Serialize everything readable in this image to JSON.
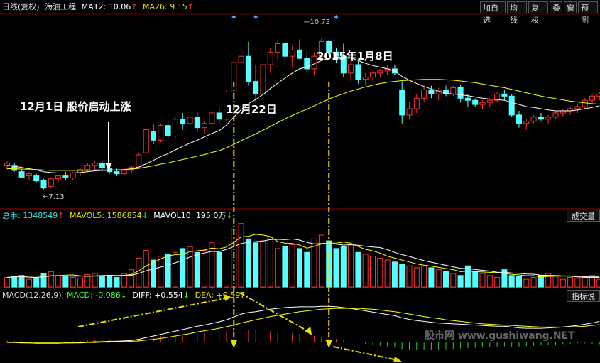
{
  "header": {
    "period": "日线(复权)",
    "stock_name": "海油工程",
    "ma12_label": "MA12:",
    "ma12_value": "10.06",
    "ma26_label": "MA26:",
    "ma26_value": "9.15",
    "arrow_up": "↑",
    "arrow_down": "↓"
  },
  "toolbar": {
    "buttons": [
      "加自选",
      "均线",
      "复权",
      "叠",
      "窗",
      "预测"
    ]
  },
  "volume_header": {
    "total_label": "总手:",
    "total_value": "1348549",
    "mavol5_label": "MAVOL5:",
    "mavol5_value": "1586854",
    "mavol10_label": "MAVOL10:",
    "mavol10_value": "195.0万"
  },
  "volume_tab": "成交量",
  "macd_header": {
    "name": "MACD(12,26,9)",
    "macd_label": "MACD:",
    "macd_value": "-0.086",
    "diff_label": "DIFF:",
    "diff_value": "+0.554",
    "dea_label": "DEA:",
    "dea_value": "+0.597"
  },
  "macd_tab": "指标说",
  "annotations": {
    "dec1": "12月1日 股价启动上涨",
    "dec22": "12月22日",
    "jan8": "2015年1月8日"
  },
  "price_marks": {
    "high": "10.73",
    "low": "7.13"
  },
  "watermark": "股市网 www.gushiwang.NET",
  "colors": {
    "up": "#ff3030",
    "down": "#54ffff",
    "ma12": "#ffffff",
    "ma26": "#ffff00",
    "ann_line": "#e8e000",
    "label_cyan": "#40e0e0",
    "label_yellow": "#e8e000",
    "label_magenta": "#ff40ff",
    "label_red": "#ff4040",
    "label_green": "#40ff40"
  },
  "chart_data": {
    "type": "candlestick",
    "price_scale": [
      6.8,
      11.2
    ],
    "candles": [
      [
        7.7,
        7.8,
        7.6,
        7.75
      ],
      [
        7.7,
        7.75,
        7.55,
        7.58
      ],
      [
        7.55,
        7.6,
        7.4,
        7.42
      ],
      [
        7.45,
        7.55,
        7.35,
        7.5
      ],
      [
        7.45,
        7.5,
        7.3,
        7.33
      ],
      [
        7.35,
        7.38,
        7.13,
        7.16
      ],
      [
        7.2,
        7.4,
        7.15,
        7.38
      ],
      [
        7.38,
        7.48,
        7.3,
        7.45
      ],
      [
        7.45,
        7.55,
        7.35,
        7.4
      ],
      [
        7.4,
        7.55,
        7.35,
        7.52
      ],
      [
        7.52,
        7.65,
        7.45,
        7.6
      ],
      [
        7.6,
        7.75,
        7.55,
        7.7
      ],
      [
        7.7,
        7.8,
        7.6,
        7.75
      ],
      [
        7.75,
        7.8,
        7.6,
        7.65
      ],
      [
        7.62,
        7.7,
        7.5,
        7.55
      ],
      [
        7.55,
        7.62,
        7.45,
        7.5
      ],
      [
        7.5,
        7.65,
        7.45,
        7.58
      ],
      [
        7.58,
        7.7,
        7.5,
        7.66
      ],
      [
        7.66,
        8.0,
        7.62,
        7.95
      ],
      [
        8.0,
        8.6,
        7.95,
        8.55
      ],
      [
        8.5,
        8.7,
        8.2,
        8.3
      ],
      [
        8.3,
        8.7,
        8.25,
        8.65
      ],
      [
        8.65,
        8.75,
        8.3,
        8.4
      ],
      [
        8.4,
        8.85,
        8.35,
        8.8
      ],
      [
        8.8,
        8.95,
        8.55,
        8.7
      ],
      [
        8.7,
        8.9,
        8.55,
        8.85
      ],
      [
        8.85,
        8.95,
        8.5,
        8.6
      ],
      [
        8.6,
        8.75,
        8.45,
        8.7
      ],
      [
        8.7,
        9.0,
        8.6,
        8.95
      ],
      [
        8.95,
        9.1,
        8.7,
        8.8
      ],
      [
        8.8,
        9.5,
        8.75,
        9.45
      ],
      [
        9.45,
        10.2,
        9.4,
        10.15
      ],
      [
        10.15,
        10.7,
        9.8,
        10.3
      ],
      [
        10.3,
        10.65,
        9.6,
        9.7
      ],
      [
        9.7,
        10.1,
        9.2,
        9.4
      ],
      [
        9.4,
        10.2,
        9.3,
        10.1
      ],
      [
        10.1,
        10.5,
        9.9,
        10.4
      ],
      [
        10.4,
        10.7,
        10.2,
        10.6
      ],
      [
        10.6,
        10.65,
        10.1,
        10.3
      ],
      [
        10.3,
        10.55,
        10.05,
        10.45
      ],
      [
        10.45,
        10.7,
        10.2,
        10.25
      ],
      [
        10.25,
        10.4,
        9.9,
        10.0
      ],
      [
        10.0,
        10.4,
        9.85,
        10.3
      ],
      [
        10.3,
        10.73,
        10.2,
        10.65
      ],
      [
        10.65,
        10.7,
        10.3,
        10.4
      ],
      [
        10.4,
        10.5,
        10.15,
        10.3
      ],
      [
        10.3,
        10.6,
        9.8,
        9.9
      ],
      [
        9.9,
        10.2,
        9.7,
        10.1
      ],
      [
        10.1,
        10.2,
        9.65,
        9.75
      ],
      [
        9.75,
        9.9,
        9.6,
        9.8
      ],
      [
        9.8,
        9.95,
        9.7,
        9.9
      ],
      [
        9.9,
        10.0,
        9.8,
        9.95
      ],
      [
        9.95,
        10.1,
        9.85,
        10.0
      ],
      [
        10.0,
        10.1,
        9.85,
        9.9
      ],
      [
        9.5,
        9.7,
        8.7,
        8.9
      ],
      [
        8.9,
        9.2,
        8.8,
        9.05
      ],
      [
        9.05,
        9.4,
        8.95,
        9.3
      ],
      [
        9.3,
        9.6,
        9.2,
        9.5
      ],
      [
        9.5,
        9.6,
        9.3,
        9.4
      ],
      [
        9.4,
        9.55,
        9.25,
        9.5
      ],
      [
        9.5,
        9.6,
        9.35,
        9.4
      ],
      [
        9.4,
        9.6,
        9.35,
        9.55
      ],
      [
        9.55,
        9.62,
        9.2,
        9.3
      ],
      [
        9.3,
        9.4,
        9.1,
        9.25
      ],
      [
        9.25,
        9.3,
        9.1,
        9.15
      ],
      [
        9.15,
        9.25,
        9.05,
        9.2
      ],
      [
        9.2,
        9.3,
        9.1,
        9.25
      ],
      [
        9.25,
        9.45,
        9.2,
        9.4
      ],
      [
        9.4,
        9.5,
        9.25,
        9.35
      ],
      [
        9.35,
        9.4,
        8.85,
        8.9
      ],
      [
        8.9,
        9.0,
        8.6,
        8.7
      ],
      [
        8.7,
        8.8,
        8.55,
        8.75
      ],
      [
        8.75,
        8.9,
        8.7,
        8.85
      ],
      [
        8.85,
        8.95,
        8.75,
        8.8
      ],
      [
        8.8,
        8.9,
        8.7,
        8.85
      ],
      [
        8.85,
        9.0,
        8.8,
        8.95
      ],
      [
        8.95,
        9.05,
        8.85,
        9.0
      ],
      [
        9.0,
        9.1,
        8.9,
        9.05
      ],
      [
        9.05,
        9.15,
        8.95,
        9.1
      ],
      [
        9.1,
        9.3,
        9.05,
        9.25
      ],
      [
        9.25,
        9.4,
        9.15,
        9.35
      ],
      [
        9.35,
        9.45,
        9.25,
        9.4
      ]
    ],
    "ma12": [
      7.7,
      7.68,
      7.65,
      7.62,
      7.59,
      7.55,
      7.53,
      7.52,
      7.52,
      7.52,
      7.53,
      7.55,
      7.57,
      7.58,
      7.58,
      7.59,
      7.6,
      7.62,
      7.66,
      7.74,
      7.82,
      7.91,
      7.98,
      8.07,
      8.15,
      8.23,
      8.3,
      8.38,
      8.46,
      8.53,
      8.66,
      8.85,
      9.03,
      9.17,
      9.27,
      9.39,
      9.53,
      9.66,
      9.78,
      9.9,
      10.0,
      10.05,
      10.12,
      10.2,
      10.25,
      10.28,
      10.27,
      10.26,
      10.2,
      10.13,
      10.08,
      10.04,
      10.0,
      9.95,
      9.82,
      9.73,
      9.65,
      9.58,
      9.52,
      9.47,
      9.42,
      9.4,
      9.38,
      9.36,
      9.33,
      9.3,
      9.28,
      9.27,
      9.25,
      9.2,
      9.15,
      9.1,
      9.08,
      9.05,
      9.02,
      9.0,
      9.0,
      9.0,
      9.02,
      9.05,
      9.08,
      9.12
    ],
    "ma26": [
      7.62,
      7.62,
      7.61,
      7.61,
      7.6,
      7.59,
      7.58,
      7.58,
      7.58,
      7.58,
      7.58,
      7.58,
      7.59,
      7.59,
      7.59,
      7.59,
      7.6,
      7.61,
      7.63,
      7.66,
      7.69,
      7.73,
      7.76,
      7.8,
      7.84,
      7.88,
      7.92,
      7.96,
      8.01,
      8.05,
      8.12,
      8.2,
      8.29,
      8.37,
      8.45,
      8.54,
      8.63,
      8.72,
      8.81,
      8.89,
      8.97,
      9.04,
      9.12,
      9.2,
      9.28,
      9.35,
      9.41,
      9.47,
      9.52,
      9.57,
      9.61,
      9.65,
      9.68,
      9.7,
      9.72,
      9.73,
      9.74,
      9.75,
      9.75,
      9.75,
      9.74,
      9.73,
      9.71,
      9.69,
      9.67,
      9.64,
      9.61,
      9.58,
      9.55,
      9.51,
      9.47,
      9.43,
      9.39,
      9.35,
      9.32,
      9.29,
      9.26,
      9.23,
      9.21,
      9.19,
      9.17,
      9.16
    ],
    "volume": [
      50,
      55,
      60,
      40,
      45,
      70,
      80,
      60,
      55,
      50,
      45,
      65,
      70,
      55,
      60,
      50,
      70,
      90,
      150,
      190,
      140,
      160,
      170,
      180,
      200,
      210,
      180,
      190,
      230,
      180,
      260,
      300,
      330,
      250,
      230,
      240,
      260,
      200,
      210,
      220,
      200,
      180,
      250,
      270,
      240,
      200,
      210,
      220,
      180,
      170,
      160,
      150,
      140,
      130,
      120,
      110,
      100,
      110,
      100,
      90,
      80,
      70,
      60,
      110,
      80,
      70,
      60,
      50,
      90,
      60,
      55,
      40,
      50,
      60,
      70,
      60,
      40,
      50,
      45,
      55,
      60,
      40
    ],
    "volume_scale": [
      0,
      340
    ],
    "macd_hist": [
      0.05,
      0.04,
      0.03,
      0.02,
      0.02,
      0.01,
      0.02,
      0.02,
      0.03,
      0.03,
      0.04,
      0.05,
      0.06,
      0.06,
      0.06,
      0.05,
      0.06,
      0.07,
      0.09,
      0.12,
      0.14,
      0.16,
      0.17,
      0.18,
      0.2,
      0.22,
      0.22,
      0.23,
      0.25,
      0.26,
      0.28,
      0.31,
      0.33,
      0.32,
      0.3,
      0.29,
      0.28,
      0.27,
      0.25,
      0.23,
      0.21,
      0.18,
      0.16,
      0.14,
      0.12,
      0.09,
      0.06,
      0.03,
      0.0,
      -0.03,
      -0.06,
      -0.08,
      -0.1,
      -0.12,
      -0.16,
      -0.17,
      -0.18,
      -0.19,
      -0.19,
      -0.18,
      -0.17,
      -0.16,
      -0.15,
      -0.14,
      -0.13,
      -0.12,
      -0.11,
      -0.1,
      -0.09,
      -0.1,
      -0.1,
      -0.09,
      -0.08,
      -0.07,
      -0.06,
      -0.05,
      -0.04,
      -0.03,
      -0.02,
      -0.02,
      -0.03,
      -0.04
    ],
    "macd_diff": [
      0.0,
      0.0,
      -0.01,
      -0.01,
      -0.02,
      -0.02,
      -0.02,
      -0.02,
      -0.01,
      -0.01,
      0.0,
      0.01,
      0.02,
      0.02,
      0.03,
      0.03,
      0.04,
      0.05,
      0.08,
      0.12,
      0.16,
      0.2,
      0.24,
      0.28,
      0.32,
      0.36,
      0.4,
      0.43,
      0.47,
      0.51,
      0.56,
      0.63,
      0.7,
      0.74,
      0.76,
      0.79,
      0.82,
      0.84,
      0.86,
      0.87,
      0.88,
      0.88,
      0.88,
      0.89,
      0.89,
      0.88,
      0.86,
      0.84,
      0.81,
      0.78,
      0.75,
      0.72,
      0.69,
      0.66,
      0.61,
      0.57,
      0.54,
      0.52,
      0.5,
      0.48,
      0.47,
      0.46,
      0.45,
      0.44,
      0.43,
      0.42,
      0.41,
      0.4,
      0.4,
      0.38,
      0.36,
      0.35,
      0.35,
      0.35,
      0.36,
      0.37,
      0.38,
      0.4,
      0.42,
      0.45,
      0.48,
      0.52
    ],
    "macd_dea": [
      0.0,
      0.0,
      0.0,
      -0.01,
      -0.01,
      -0.01,
      -0.01,
      -0.01,
      -0.01,
      -0.01,
      -0.01,
      0.0,
      0.0,
      0.01,
      0.01,
      0.02,
      0.02,
      0.03,
      0.04,
      0.06,
      0.08,
      0.1,
      0.13,
      0.16,
      0.19,
      0.22,
      0.26,
      0.29,
      0.32,
      0.35,
      0.39,
      0.43,
      0.48,
      0.52,
      0.56,
      0.6,
      0.64,
      0.67,
      0.7,
      0.73,
      0.76,
      0.78,
      0.8,
      0.82,
      0.83,
      0.84,
      0.84,
      0.84,
      0.84,
      0.83,
      0.82,
      0.8,
      0.78,
      0.76,
      0.73,
      0.7,
      0.67,
      0.64,
      0.61,
      0.59,
      0.56,
      0.54,
      0.52,
      0.5,
      0.48,
      0.46,
      0.45,
      0.44,
      0.43,
      0.42,
      0.41,
      0.4,
      0.39,
      0.38,
      0.38,
      0.38,
      0.38,
      0.38,
      0.39,
      0.4,
      0.42,
      0.44
    ],
    "macd_scale": [
      -0.4,
      1.0
    ],
    "markers": [
      {
        "type": "vline",
        "at": 31
      },
      {
        "type": "vline",
        "at": 44
      }
    ]
  }
}
